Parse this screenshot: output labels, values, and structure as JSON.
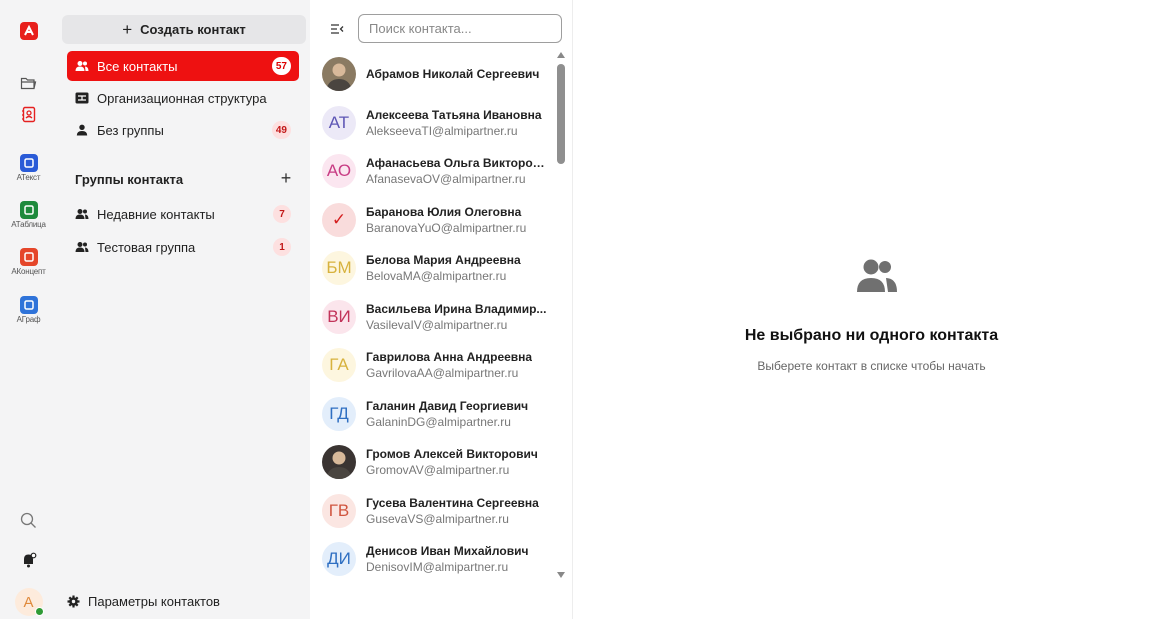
{
  "rail": {
    "apps": [
      {
        "label": "АТекст",
        "icon": "atext-app-icon",
        "color": "#2a5bd7"
      },
      {
        "label": "АТаблица",
        "icon": "atable-app-icon",
        "color": "#1e8a3c"
      },
      {
        "label": "АКонцепт",
        "icon": "aconcept-app-icon",
        "color": "#e5462a"
      },
      {
        "label": "АГраф",
        "icon": "agraph-app-icon",
        "color": "#2f73d9"
      }
    ],
    "user_initial": "A"
  },
  "groups": {
    "create_label": "Создать контакт",
    "nav": [
      {
        "label": "Все контакты",
        "count": "57",
        "icon": "people-icon"
      },
      {
        "label": "Организационная структура",
        "count": "",
        "icon": "org-structure-icon"
      },
      {
        "label": "Без группы",
        "count": "49",
        "icon": "person-icon"
      }
    ],
    "section_title": "Группы контакта",
    "custom": [
      {
        "label": "Недавние контакты",
        "count": "7"
      },
      {
        "label": "Тестовая группа",
        "count": "1"
      }
    ],
    "settings_label": "Параметры контактов"
  },
  "list": {
    "search_placeholder": "Поиск контакта...",
    "contacts": [
      {
        "name": "Абрамов Николай Сергеевич",
        "email": "",
        "initials": "",
        "photo": true,
        "bg": "#8a7a62",
        "fg": "#fff"
      },
      {
        "name": "Алексеева Татьяна Ивановна",
        "email": "AlekseevaTI@almipartner.ru",
        "initials": "АТ",
        "photo": false,
        "bg": "#ece9f7",
        "fg": "#5e56b5"
      },
      {
        "name": "Афанасьева Ольга Викторов...",
        "email": "AfanasevaOV@almipartner.ru",
        "initials": "АО",
        "photo": false,
        "bg": "#fbe6f0",
        "fg": "#c83c84"
      },
      {
        "name": "Баранова Юлия Олеговна",
        "email": "BaranovaYuO@almipartner.ru",
        "initials": "✓",
        "photo": false,
        "bg": "#f9dcdc",
        "fg": "#d41f1f"
      },
      {
        "name": "Белова Мария Андреевна",
        "email": "BelovaMA@almipartner.ru",
        "initials": "БМ",
        "photo": false,
        "bg": "#fdf6df",
        "fg": "#d7b23d"
      },
      {
        "name": "Васильева Ирина Владимир...",
        "email": "VasilevaIV@almipartner.ru",
        "initials": "ВИ",
        "photo": false,
        "bg": "#fbe5ec",
        "fg": "#c2345a"
      },
      {
        "name": "Гаврилова Анна Андреевна",
        "email": "GavrilovaAA@almipartner.ru",
        "initials": "ГА",
        "photo": false,
        "bg": "#fdf6df",
        "fg": "#d7b23d"
      },
      {
        "name": "Галанин Давид Георгиевич",
        "email": "GalaninDG@almipartner.ru",
        "initials": "ГД",
        "photo": false,
        "bg": "#e3eefb",
        "fg": "#2f6fc2"
      },
      {
        "name": "Громов Алексей Викторович",
        "email": "GromovAV@almipartner.ru",
        "initials": "",
        "photo": true,
        "bg": "#3a3432",
        "fg": "#fff"
      },
      {
        "name": "Гусева Валентина Сергеевна",
        "email": "GusevaVS@almipartner.ru",
        "initials": "ГВ",
        "photo": false,
        "bg": "#fbe6e2",
        "fg": "#d0553f"
      },
      {
        "name": "Денисов Иван Михайлович",
        "email": "DenisovIM@almipartner.ru",
        "initials": "ДИ",
        "photo": false,
        "bg": "#e3eefb",
        "fg": "#2f6fc2"
      }
    ]
  },
  "empty": {
    "title": "Не выбрано ни одного контакта",
    "subtitle": "Выберете контакт в списке чтобы начать"
  },
  "colors": {
    "accent": "#ee1111",
    "badge_bg": "#fde0e0",
    "badge_fg": "#c21818"
  }
}
